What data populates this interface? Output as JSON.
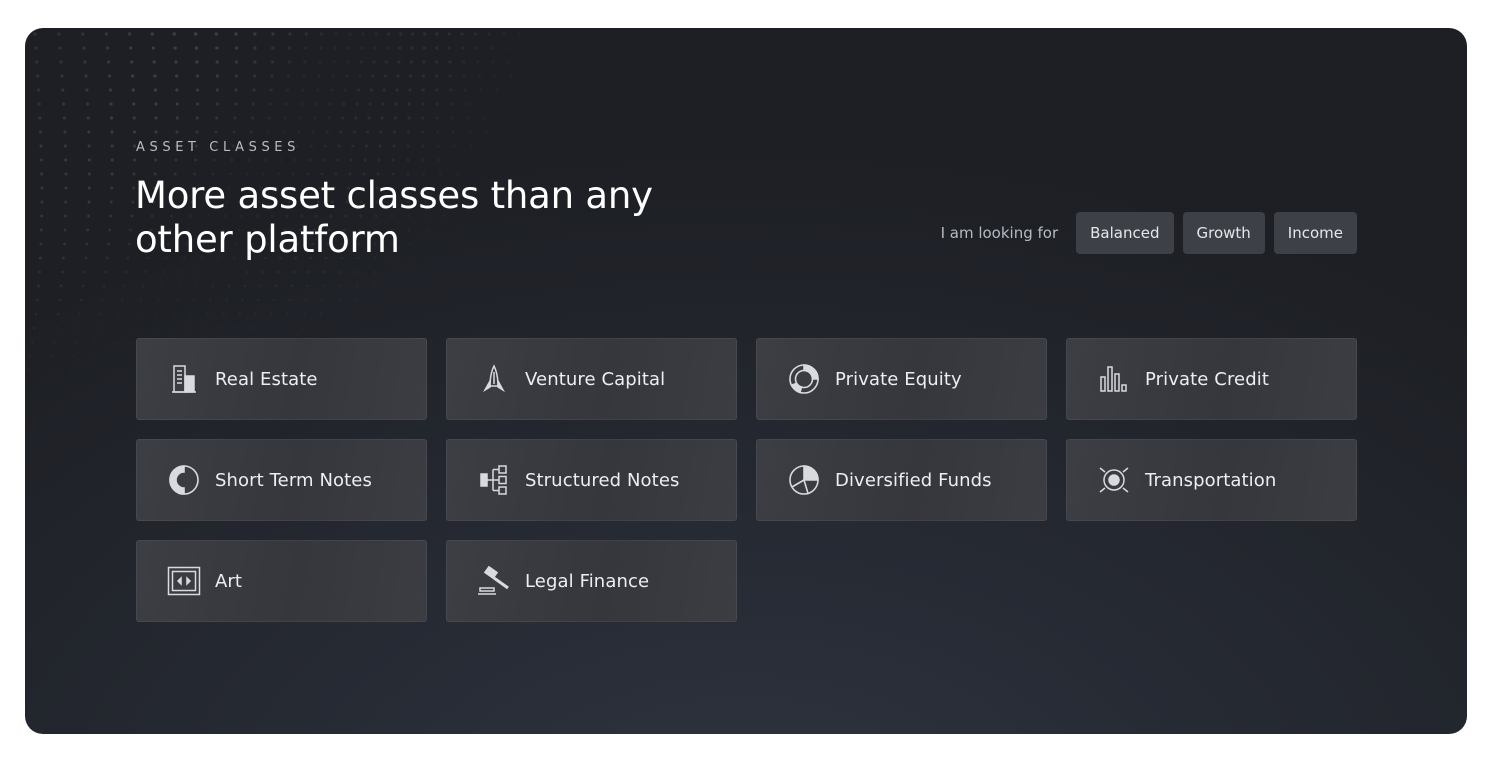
{
  "section": {
    "eyebrow": "ASSET CLASSES",
    "headline": "More asset classes than any other platform"
  },
  "filters": {
    "label": "I am looking for",
    "options": [
      "Balanced",
      "Growth",
      "Income"
    ]
  },
  "asset_classes": [
    {
      "label": "Real Estate",
      "icon": "building-icon"
    },
    {
      "label": "Venture Capital",
      "icon": "rocket-icon"
    },
    {
      "label": "Private Equity",
      "icon": "ring-chart-icon"
    },
    {
      "label": "Private Credit",
      "icon": "bar-chart-icon"
    },
    {
      "label": "Short Term Notes",
      "icon": "half-circle-icon"
    },
    {
      "label": "Structured Notes",
      "icon": "tree-structure-icon"
    },
    {
      "label": "Diversified Funds",
      "icon": "pie-chart-icon"
    },
    {
      "label": "Transportation",
      "icon": "target-icon"
    },
    {
      "label": "Art",
      "icon": "picture-frame-icon"
    },
    {
      "label": "Legal Finance",
      "icon": "gavel-icon"
    }
  ],
  "colors": {
    "panel_background": "#1d1f24",
    "card_background": "#3a3c42",
    "filter_button": "#3e4047",
    "text_primary": "#ffffff",
    "text_muted": "#b7bac2"
  }
}
